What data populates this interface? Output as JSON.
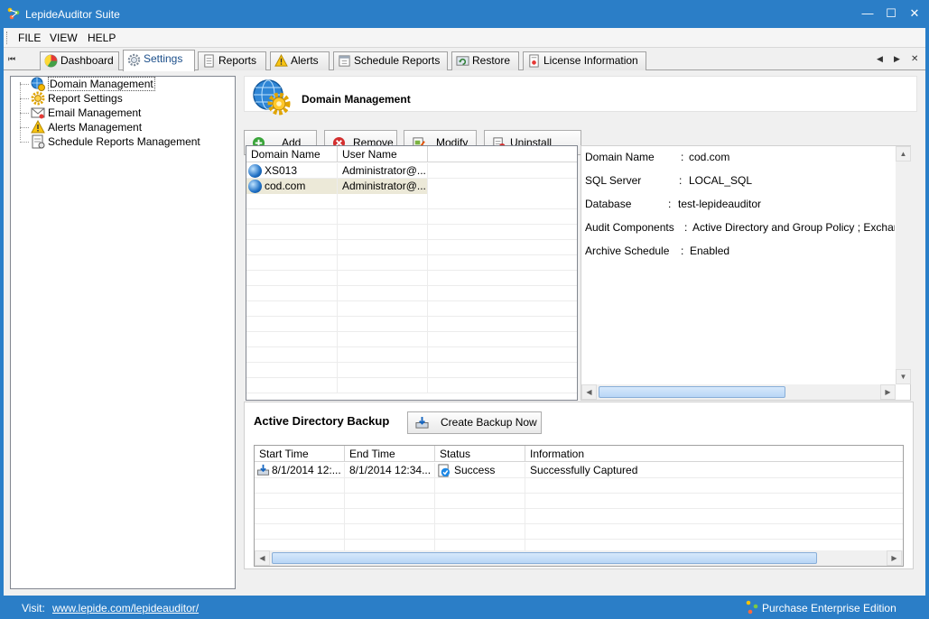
{
  "window": {
    "title": "LepideAuditor Suite",
    "minimize": "—",
    "maximize": "☐",
    "close": "✕"
  },
  "menu": [
    "FILE",
    "VIEW",
    "HELP"
  ],
  "tabs": [
    {
      "label": "Dashboard",
      "icon": "dashboard-icon"
    },
    {
      "label": "Settings",
      "icon": "gear-icon",
      "active": true
    },
    {
      "label": "Reports",
      "icon": "reports-icon"
    },
    {
      "label": "Alerts",
      "icon": "warning-icon"
    },
    {
      "label": "Schedule Reports",
      "icon": "schedule-icon"
    },
    {
      "label": "Restore",
      "icon": "restore-icon"
    },
    {
      "label": "License Information",
      "icon": "license-icon"
    }
  ],
  "tab_nav": {
    "first": "⏮",
    "prev": "◀",
    "next": "▶",
    "close": "✕"
  },
  "tree": [
    {
      "label": "Domain Management",
      "icon": "globe-gear-icon",
      "selected": true
    },
    {
      "label": "Report Settings",
      "icon": "gear-icon"
    },
    {
      "label": "Email Management",
      "icon": "email-icon"
    },
    {
      "label": "Alerts Management",
      "icon": "warning-icon"
    },
    {
      "label": "Schedule Reports Management",
      "icon": "schedule-icon"
    }
  ],
  "section": {
    "title": "Domain Management",
    "icon": "globe-gear-icon"
  },
  "buttons": {
    "add": "Add",
    "remove": "Remove",
    "modify": "Modify",
    "uninstall": "Uninstall Agent",
    "create_backup": "Create Backup Now"
  },
  "domain_grid": {
    "columns": [
      "Domain Name",
      "User Name"
    ],
    "rows": [
      {
        "domain": "XS013",
        "user": "Administrator@..."
      },
      {
        "domain": "cod.com",
        "user": "Administrator@...",
        "selected": true
      }
    ]
  },
  "details": [
    {
      "key": "Domain Name",
      "value": "cod.com"
    },
    {
      "key": "SQL Server",
      "value": "LOCAL_SQL"
    },
    {
      "key": "Database",
      "value": "test-lepideauditor"
    },
    {
      "key": "Audit Components",
      "value": "Active Directory and Group Policy ; Exchange S"
    },
    {
      "key": "Archive Schedule",
      "value": "Enabled"
    }
  ],
  "backup": {
    "title": "Active Directory Backup",
    "columns": [
      "Start Time",
      "End Time",
      "Status",
      "Information"
    ],
    "rows": [
      {
        "start": "8/1/2014 12:...",
        "end": "8/1/2014 12:34...",
        "status": "Success",
        "info": "Successfully Captured"
      }
    ]
  },
  "status": {
    "visit": "Visit:",
    "link": "www.lepide.com/lepideauditor/",
    "purchase": "Purchase Enterprise Edition"
  },
  "colors": {
    "accent": "#2b7ec7",
    "selection": "#ece9d8",
    "scroll_thumb": "#b8d6f6"
  }
}
